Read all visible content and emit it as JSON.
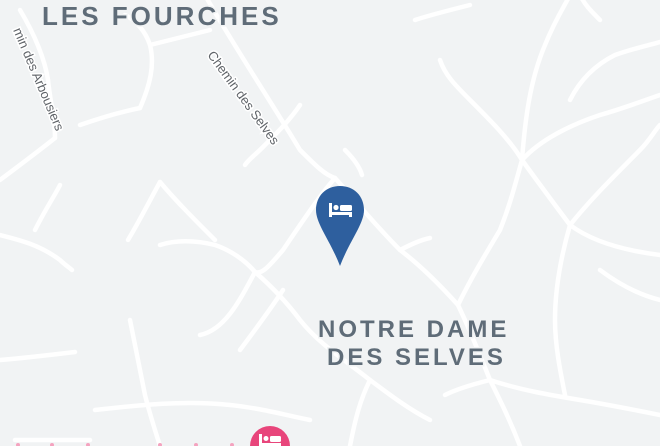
{
  "map": {
    "areas": [
      {
        "name": "LES FOURCHES"
      },
      {
        "name_line1": "NOTRE DAME",
        "name_line2": "DES SELVES"
      }
    ],
    "streets": [
      {
        "name": "Chemin des Selves"
      },
      {
        "name": "min des Arbousiers"
      }
    ],
    "markers": [
      {
        "icon": "hotel-bed-icon",
        "color": "#2e5f9e",
        "selected": true
      },
      {
        "icon": "hotel-bed-icon",
        "color": "#e8457b",
        "selected": false
      }
    ],
    "colors": {
      "background": "#f1f3f4",
      "road": "#ffffff",
      "label": "#5f6c78"
    }
  }
}
